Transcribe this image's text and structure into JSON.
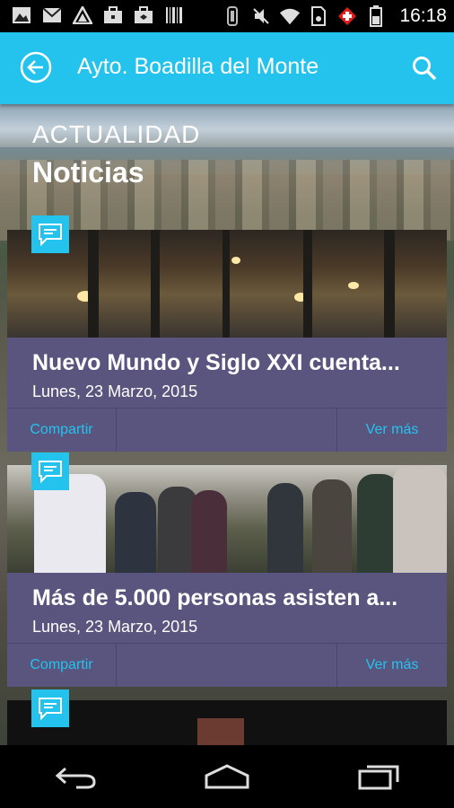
{
  "status_bar": {
    "time": "16:18",
    "left_icons": [
      "image-icon",
      "mail-icon",
      "triangle-icon",
      "briefcase-icon",
      "briefcase-icon",
      "barcode-icon"
    ],
    "right_icons": [
      "vibrate-icon",
      "mute-icon",
      "wifi-icon",
      "sim-icon",
      "swiss-flag-icon",
      "battery-icon"
    ]
  },
  "app_bar": {
    "title": "Ayto. Boadilla del Monte"
  },
  "section": {
    "label": "ACTUALIDAD",
    "title": "Noticias"
  },
  "cards": [
    {
      "title": "Nuevo Mundo y Siglo XXI cuenta...",
      "date": "Lunes, 23 Marzo, 2015",
      "share_label": "Compartir",
      "more_label": "Ver más"
    },
    {
      "title": "Más de 5.000 personas asisten a...",
      "date": "Lunes, 23 Marzo, 2015",
      "share_label": "Compartir",
      "more_label": "Ver más"
    }
  ],
  "nav_bar": {
    "buttons": [
      "back-icon",
      "home-icon",
      "recent-apps-icon"
    ]
  },
  "colors": {
    "accent": "#23c3ee",
    "card": "#5a557e"
  }
}
